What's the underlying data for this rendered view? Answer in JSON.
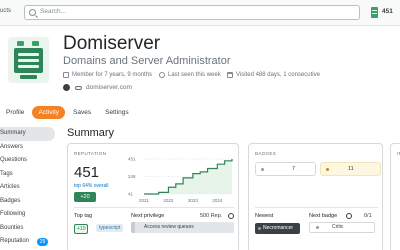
{
  "topbar": {
    "nav_label": "ucts",
    "search_placeholder": "Search...",
    "reputation": "451"
  },
  "profile": {
    "name": "Domiserver",
    "title": "Domains and Server Administrator",
    "member_for": "Member for 7 years, 9 months",
    "last_seen": "Last seen this week",
    "visited": "Visited 488 days, 1 consecutive",
    "website": "domiserver.com"
  },
  "tabs": [
    {
      "label": "Profile"
    },
    {
      "label": "Activity",
      "active": true
    },
    {
      "label": "Saves"
    },
    {
      "label": "Settings"
    }
  ],
  "leftnav": {
    "items": [
      {
        "label": "Summary",
        "active": true
      },
      {
        "label": "Answers"
      },
      {
        "label": "Questions"
      },
      {
        "label": "Tags"
      },
      {
        "label": "Articles"
      },
      {
        "label": "Badges"
      },
      {
        "label": "Following"
      },
      {
        "label": "Bounties"
      },
      {
        "label": "Reputation",
        "badge": "29"
      }
    ]
  },
  "summary": {
    "title": "Summary",
    "reputation_card": {
      "header": "REPUTATION",
      "value": "451",
      "percentile": "top 64% overall",
      "change": "+20",
      "top_tag_header": "Top tag",
      "top_tag_score": "+10",
      "top_tag": "typescript",
      "next_privilege_header": "Next privilege",
      "next_privilege_rep": "500 Rep.",
      "next_privilege": "Access review queues"
    },
    "badges_card": {
      "header": "BADGES",
      "silver_count": "7",
      "bronze_count": "11",
      "newest_header": "Newest",
      "newest_badge": "Necromancer",
      "next_badge_header": "Next badge",
      "next_badge_progress": "0/1",
      "next_badge": "Critic"
    },
    "third_card": {
      "header": "IM"
    }
  },
  "chart_data": {
    "type": "line",
    "x": [
      2021,
      2021.3,
      2021.6,
      2022,
      2022.3,
      2022.6,
      2023,
      2023.3,
      2023.6,
      2024,
      2024.3,
      2024.6
    ],
    "series": [
      {
        "values": [
          41,
          41,
          60,
          120,
          160,
          230,
          280,
          300,
          340,
          390,
          430,
          451
        ]
      }
    ],
    "xticks": [
      "2021",
      "2022",
      "2023",
      "2024"
    ],
    "yticks": [
      "451",
      "246",
      "41"
    ],
    "ylim": [
      41,
      451
    ],
    "xlim": [
      2021,
      2024.6
    ],
    "colors": {
      "line": "#2f855a"
    }
  }
}
